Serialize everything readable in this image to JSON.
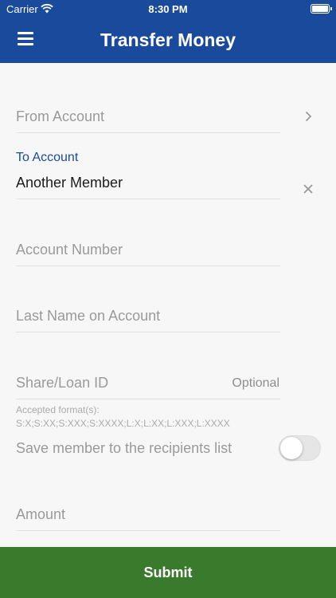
{
  "status_bar": {
    "carrier": "Carrier",
    "time": "8:30 PM",
    "icons": [
      "wifi-icon",
      "battery-icon"
    ]
  },
  "header": {
    "title": "Transfer Money",
    "menu_icon": "hamburger-menu-icon"
  },
  "form": {
    "from_account": {
      "placeholder": "From Account",
      "icon": "chevron-right-icon"
    },
    "to_account": {
      "label": "To Account",
      "value": "Another Member",
      "icon": "close-icon"
    },
    "account_number": {
      "placeholder": "Account Number"
    },
    "last_name": {
      "placeholder": "Last Name on Account"
    },
    "share_loan_id": {
      "placeholder": "Share/Loan ID",
      "optional_label": "Optional",
      "hint_title": "Accepted format(s):",
      "hint_formats": "S:X;S:XX;S:XXX;S:XXXX;L:X;L:XX;L:XXX;L:XXXX"
    },
    "save_member": {
      "label": "Save member to the recipients list",
      "enabled": false
    },
    "amount": {
      "placeholder": "Amount"
    }
  },
  "submit": {
    "label": "Submit"
  },
  "colors": {
    "header": "#1a4a9c",
    "submit": "#3a7a2c",
    "label_accent": "#1a4a9c"
  }
}
